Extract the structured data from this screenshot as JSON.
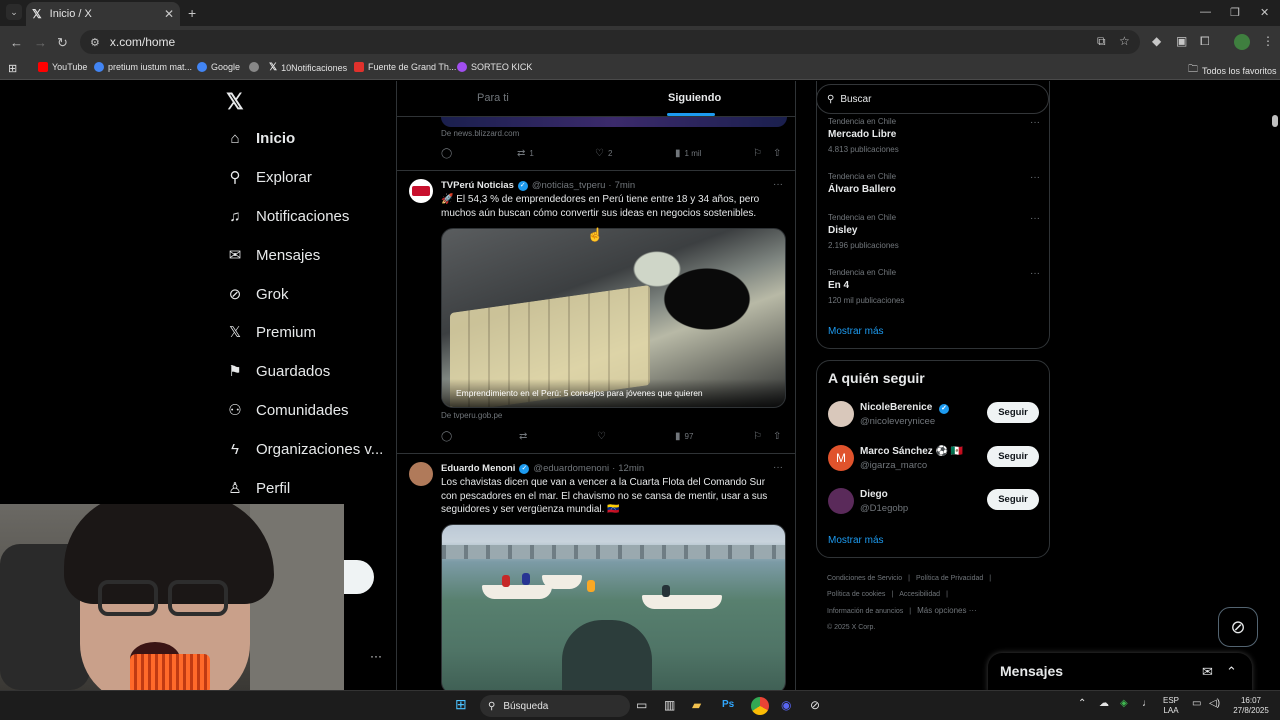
{
  "browser": {
    "tab_title": "Inicio / X",
    "url": "x.com/home",
    "bookmarks": [
      {
        "label": "YouTube",
        "color": "#ff0000"
      },
      {
        "label": "pretium iustum mat...",
        "color": "#4285f4"
      },
      {
        "label": "Google",
        "color": "#4285f4"
      },
      {
        "label": "",
        "color": "#888888"
      },
      {
        "label": "10Notificaciones",
        "color": "#e7e9ea"
      },
      {
        "label": "Fuente de Grand Th...",
        "color": "#e0312c"
      },
      {
        "label": "SORTEO KICK",
        "color": "#a14ef0"
      }
    ],
    "all_bookmarks": "Todos los favoritos"
  },
  "nav": {
    "items": [
      {
        "label": "Inicio",
        "icon": "home-icon"
      },
      {
        "label": "Explorar",
        "icon": "search-icon"
      },
      {
        "label": "Notificaciones",
        "icon": "bell-icon"
      },
      {
        "label": "Mensajes",
        "icon": "mail-icon"
      },
      {
        "label": "Grok",
        "icon": "grok-icon"
      },
      {
        "label": "Premium",
        "icon": "x-icon"
      },
      {
        "label": "Guardados",
        "icon": "bookmark-icon"
      },
      {
        "label": "Comunidades",
        "icon": "people-icon"
      },
      {
        "label": "Organizaciones v...",
        "icon": "bolt-icon"
      },
      {
        "label": "Perfil",
        "icon": "user-icon"
      }
    ]
  },
  "feed": {
    "tabs": [
      "Para ti",
      "Siguiendo"
    ],
    "prev_post": {
      "source": "De news.blizzard.com",
      "retweets": "1",
      "likes": "2",
      "views": "1 mil"
    },
    "posts": [
      {
        "name": "TVPerú Noticias",
        "handle": "@noticias_tvperu",
        "time": "7min",
        "text": "🚀 El 54,3 % de emprendedores en Perú tiene entre 18 y 34 años, pero muchos aún buscan cómo convertir sus ideas en negocios sostenibles.",
        "card_caption": "Emprendimiento en el Perú: 5 consejos para jóvenes que quieren",
        "source": "De tvperu.gob.pe",
        "views": "97"
      },
      {
        "name": "Eduardo Menoni",
        "handle": "@eduardomenoni",
        "time": "12min",
        "text": "Los chavistas dicen que van a vencer a la Cuarta Flota del Comando Sur con pescadores en el mar. El chavismo no se cansa de mentir, usar a sus seguidores y ser vergüenza mundial. 🇻🇪"
      }
    ]
  },
  "sidebar": {
    "search_placeholder": "Buscar",
    "trends": [
      {
        "context": "Tendencia en Chile",
        "name": "Mercado Libre",
        "count": "4.813 publicaciones"
      },
      {
        "context": "Tendencia en Chile",
        "name": "Álvaro Ballero",
        "count": ""
      },
      {
        "context": "Tendencia en Chile",
        "name": "Disley",
        "count": "2.196 publicaciones"
      },
      {
        "context": "Tendencia en Chile",
        "name": "En 4",
        "count": "120 mil publicaciones"
      }
    ],
    "show_more": "Mostrar más",
    "who_to_follow": {
      "title": "A quién seguir",
      "users": [
        {
          "name": "NicoleBerenice",
          "handle": "@nicoleverynicee",
          "button": "Seguir"
        },
        {
          "name": "Marco Sánchez ⚽ 🇲🇽",
          "handle": "@igarza_marco",
          "button": "Seguir",
          "initial": "M"
        },
        {
          "name": "Diego",
          "handle": "@D1egobp",
          "button": "Seguir"
        }
      ],
      "show_more": "Mostrar más"
    },
    "footer": {
      "links": [
        "Condiciones de Servicio",
        "Política de Privacidad",
        "Política de cookies",
        "Accesibilidad",
        "Información de anuncios",
        "Más opciones ···"
      ],
      "copyright": "© 2025 X Corp."
    }
  },
  "messages_dock": {
    "title": "Mensajes"
  },
  "taskbar": {
    "search": "Búsqueda",
    "lang": "ESP",
    "lang2": "LAA",
    "time": "16:07",
    "date": "27/8/2025"
  },
  "colors": {
    "accent": "#1d9bf0",
    "background": "#000000",
    "border": "#2f3336"
  }
}
